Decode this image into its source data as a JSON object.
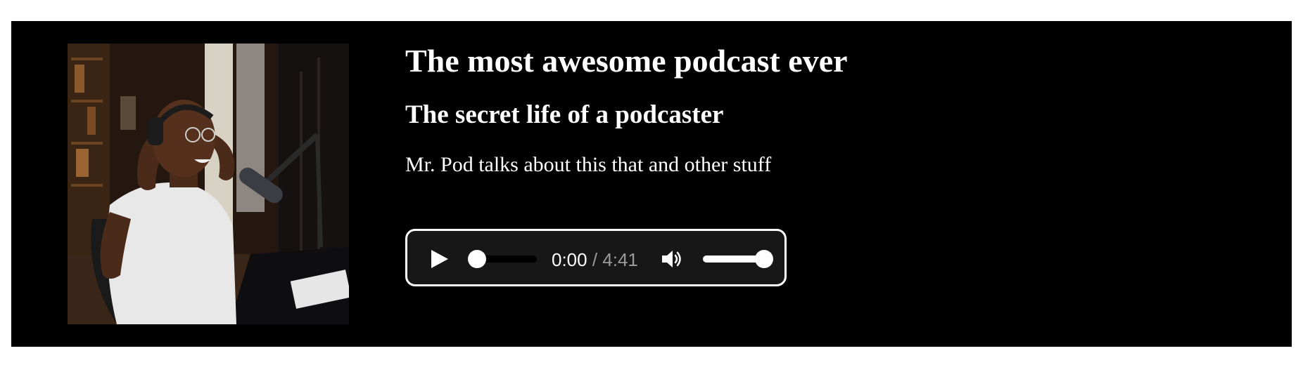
{
  "podcast": {
    "title": "The most awesome podcast ever",
    "episode_title": "The secret life of a podcaster",
    "description": "Mr. Pod talks about this that and other stuff",
    "cover_image": "man-with-headphones-at-microphone-photo"
  },
  "player": {
    "current_time": "0:00",
    "separator": " / ",
    "duration": "4:41",
    "progress": 0.0,
    "volume": 1.0,
    "play_icon": "play-icon",
    "volume_icon": "volume-high-icon"
  },
  "colors": {
    "background": "#000000",
    "page": "#ffffff",
    "text": "#ffffff",
    "player_bg": "#171717",
    "player_border": "#ffffff",
    "muted_text": "#9a9a9a"
  }
}
